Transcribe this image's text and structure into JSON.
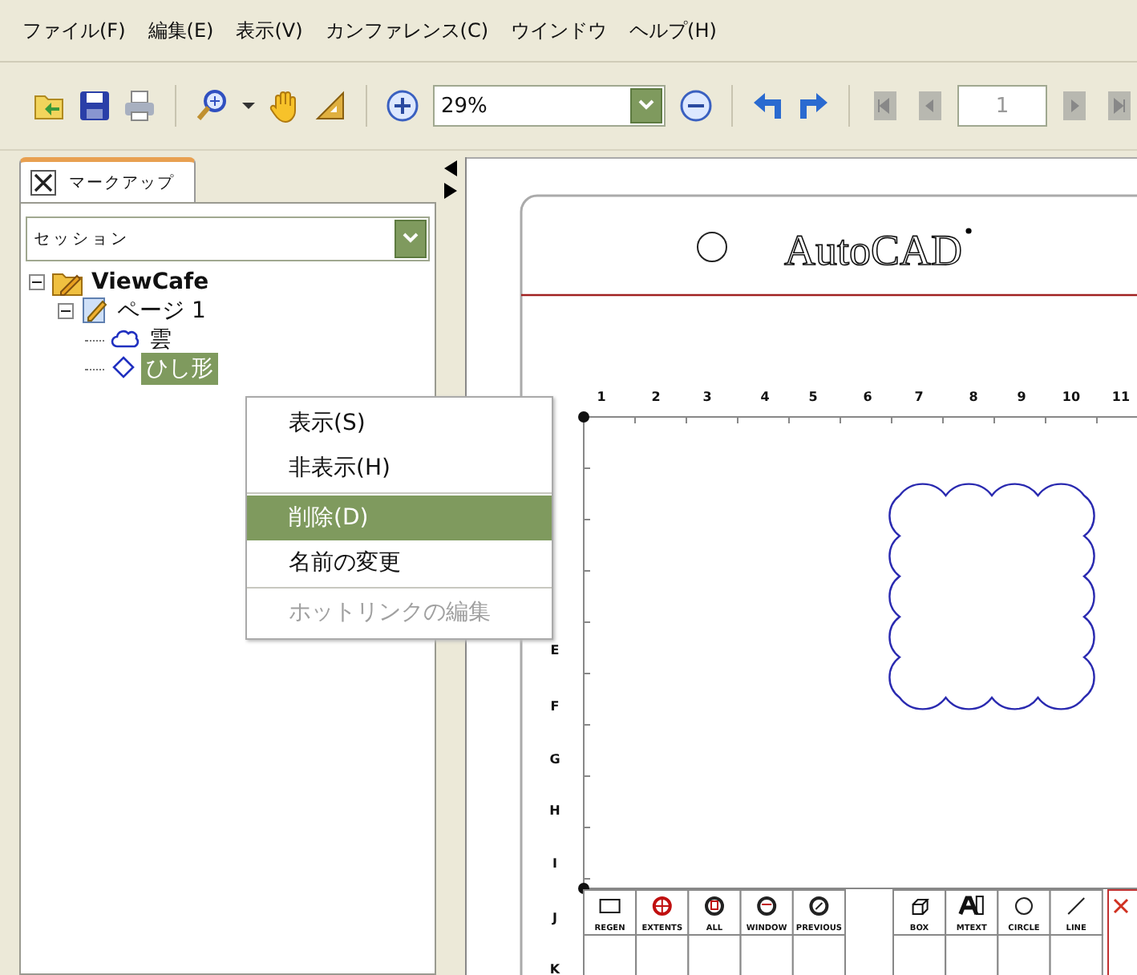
{
  "menu": [
    "ファイル(F)",
    "編集(E)",
    "表示(V)",
    "カンファレンス(C)",
    "ウインドウ",
    "ヘルプ(H)"
  ],
  "toolbar": [
    {
      "kind": "open"
    },
    {
      "kind": "save"
    },
    {
      "kind": "print"
    },
    {
      "kind": "sep"
    },
    {
      "kind": "zoom-tool"
    },
    {
      "kind": "caret"
    },
    {
      "kind": "hand"
    },
    {
      "kind": "measure"
    },
    {
      "kind": "sep"
    },
    {
      "kind": "zoom-in"
    },
    {
      "kind": "combo",
      "value": "29%"
    },
    {
      "kind": "zoom-out"
    },
    {
      "kind": "sep"
    },
    {
      "kind": "undo"
    },
    {
      "kind": "redo"
    },
    {
      "kind": "sep"
    },
    {
      "kind": "first"
    },
    {
      "kind": "prev"
    },
    {
      "kind": "page",
      "value": "1"
    },
    {
      "kind": "next"
    },
    {
      "kind": "last"
    }
  ],
  "panel": {
    "tab": "マークアップ",
    "session": "セッション",
    "tree": [
      {
        "label": "ViewCafe",
        "kind": "folder",
        "expanded": true,
        "selected": false,
        "children": [
          {
            "label": "ページ 1",
            "kind": "page",
            "expanded": true,
            "selected": false,
            "children": [
              {
                "label": "雲",
                "kind": "cloud",
                "selected": false
              },
              {
                "label": "ひし形",
                "kind": "diamond",
                "selected": true
              }
            ]
          }
        ]
      }
    ]
  },
  "context_menu": [
    {
      "label": "表示(S)",
      "selected": false,
      "disabled": false,
      "separator_before": false
    },
    {
      "label": "非表示(H)",
      "selected": false,
      "disabled": false,
      "separator_before": false
    },
    {
      "label": "削除(D)",
      "selected": true,
      "disabled": false,
      "separator_before": true
    },
    {
      "label": "名前の変更",
      "selected": false,
      "disabled": false,
      "separator_before": false
    },
    {
      "label": "ホットリンクの編集",
      "selected": false,
      "disabled": true,
      "separator_before": true
    }
  ],
  "drawing": {
    "title": "AutoCAD",
    "columns": [
      "1",
      "2",
      "3",
      "4",
      "5",
      "6",
      "7",
      "8",
      "9",
      "10",
      "11"
    ],
    "rows": [
      "E",
      "F",
      "G",
      "H",
      "I",
      "J",
      "K"
    ],
    "commands": [
      {
        "label": "REGEN",
        "kind": "regen"
      },
      {
        "label": "EXTENTS",
        "kind": "extents"
      },
      {
        "label": "ALL",
        "kind": "all"
      },
      {
        "label": "WINDOW",
        "kind": "window"
      },
      {
        "label": "PREVIOUS",
        "kind": "previous"
      }
    ],
    "tools": [
      {
        "label": "BOX",
        "kind": "box"
      },
      {
        "label": "MTEXT",
        "kind": "mtext"
      },
      {
        "label": "CIRCLE",
        "kind": "circle"
      },
      {
        "label": "LINE",
        "kind": "line"
      }
    ]
  }
}
